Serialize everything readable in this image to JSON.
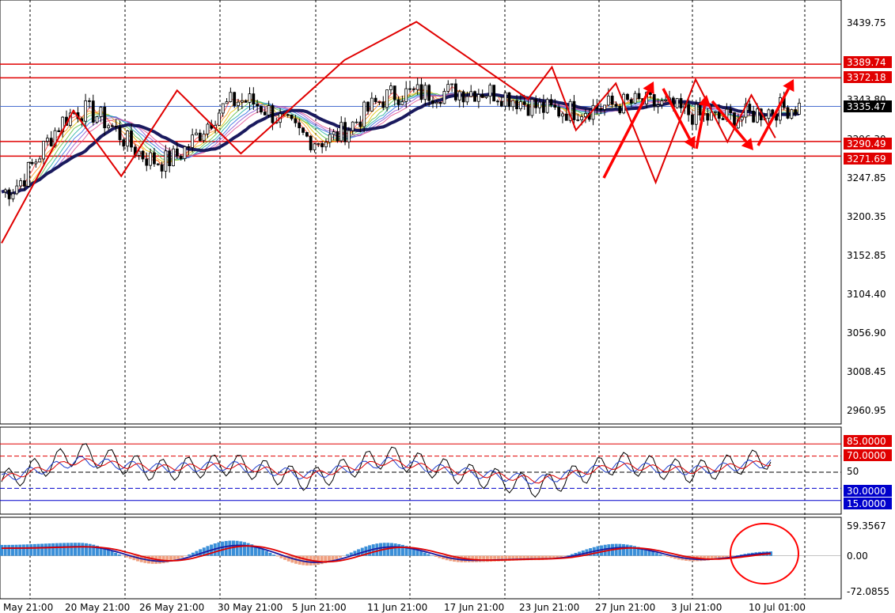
{
  "main_panel": {
    "price_ticks": [
      "3439.75",
      "3343.80",
      "3296.30",
      "3247.85",
      "3200.35",
      "3152.85",
      "3104.40",
      "3056.90",
      "3008.45",
      "2960.95"
    ],
    "levels": [
      {
        "label": "3389.74",
        "value": 3389.74,
        "color": "#e00000"
      },
      {
        "label": "3372.18",
        "value": 3372.18,
        "color": "#e00000"
      },
      {
        "label": "3290.49",
        "value": 3290.49,
        "color": "#e00000"
      },
      {
        "label": "3271.69",
        "value": 3271.69,
        "color": "#e00000"
      }
    ],
    "current_price": {
      "label": "3335.47",
      "value": 3335.47,
      "color": "#000000"
    },
    "date_ticks": [
      "May 21:00",
      "20 May 21:00",
      "26 May 21:00",
      "30 May 21:00",
      "5 Jun 21:00",
      "11 Jun 21:00",
      "17 Jun 21:00",
      "23 Jun 21:00",
      "27 Jun 21:00",
      "3 Jul 21:00",
      "10 Jul 01:00"
    ]
  },
  "oscillator_panel": {
    "levels": [
      {
        "label": "85.0000",
        "value": 85,
        "color": "#e00000"
      },
      {
        "label": "70.0000",
        "value": 70,
        "color": "#e00000"
      },
      {
        "label": "50",
        "value": 50,
        "color": "#000000"
      },
      {
        "label": "30.0000",
        "value": 30,
        "color": "#0000cc"
      },
      {
        "label": "15.0000",
        "value": 15,
        "color": "#0000cc"
      }
    ]
  },
  "macd_panel": {
    "ticks": [
      "59.3567",
      "0.00",
      "-72.0855"
    ]
  },
  "colors": {
    "candle": "#000000",
    "zigzag": "#e00000",
    "slow_ma": "#1a1a5e",
    "histogram_positive": "#3a8fd8",
    "histogram_negative": "#f0a080",
    "signal_line": "#e00000",
    "macd_line": "#1a1aa0",
    "annotation": "#ff0000"
  },
  "chart_data": [
    {
      "type": "line",
      "title": "",
      "xlabel": "",
      "ylabel": "",
      "ylim": [
        2930,
        3470
      ],
      "x": [
        "May 21:00",
        "20 May 21:00",
        "26 May 21:00",
        "30 May 21:00",
        "5 Jun 21:00",
        "11 Jun 21:00",
        "17 Jun 21:00",
        "23 Jun 21:00",
        "27 Jun 21:00",
        "3 Jul 21:00",
        "10 Jul 01:00"
      ],
      "series": [
        {
          "values": [
            3226,
            3330,
            3265,
            3343,
            3292,
            3352,
            3355,
            3330,
            3340,
            3320,
            3335
          ]
        }
      ],
      "zigzag_points": [
        {
          "x_index": 0.0,
          "value": 3160
        },
        {
          "x_index": 0.9,
          "value": 3330
        },
        {
          "x_index": 1.5,
          "value": 3246
        },
        {
          "x_index": 2.2,
          "value": 3356
        },
        {
          "x_index": 3.0,
          "value": 3275
        },
        {
          "x_index": 4.3,
          "value": 3395
        },
        {
          "x_index": 5.2,
          "value": 3444
        },
        {
          "x_index": 6.6,
          "value": 3345
        },
        {
          "x_index": 6.9,
          "value": 3386
        },
        {
          "x_index": 7.2,
          "value": 3305
        },
        {
          "x_index": 7.7,
          "value": 3365
        },
        {
          "x_index": 8.2,
          "value": 3238
        },
        {
          "x_index": 8.7,
          "value": 3370
        },
        {
          "x_index": 9.1,
          "value": 3290
        },
        {
          "x_index": 9.4,
          "value": 3350
        },
        {
          "x_index": 9.7,
          "value": 3295
        }
      ],
      "grid": true
    },
    {
      "type": "line",
      "ylim": [
        0,
        100
      ],
      "series": [
        {
          "values": [
            38,
            74,
            52,
            60,
            40,
            70,
            48,
            32,
            62,
            50,
            68
          ]
        },
        {
          "values": [
            42,
            64,
            55,
            58,
            46,
            63,
            50,
            40,
            58,
            52,
            62
          ]
        }
      ]
    },
    {
      "type": "bar",
      "ylim": [
        -72.0855,
        59.3567
      ],
      "values": [
        20,
        24,
        -15,
        28,
        -18,
        24,
        -12,
        -8,
        22,
        -10,
        8
      ]
    }
  ]
}
